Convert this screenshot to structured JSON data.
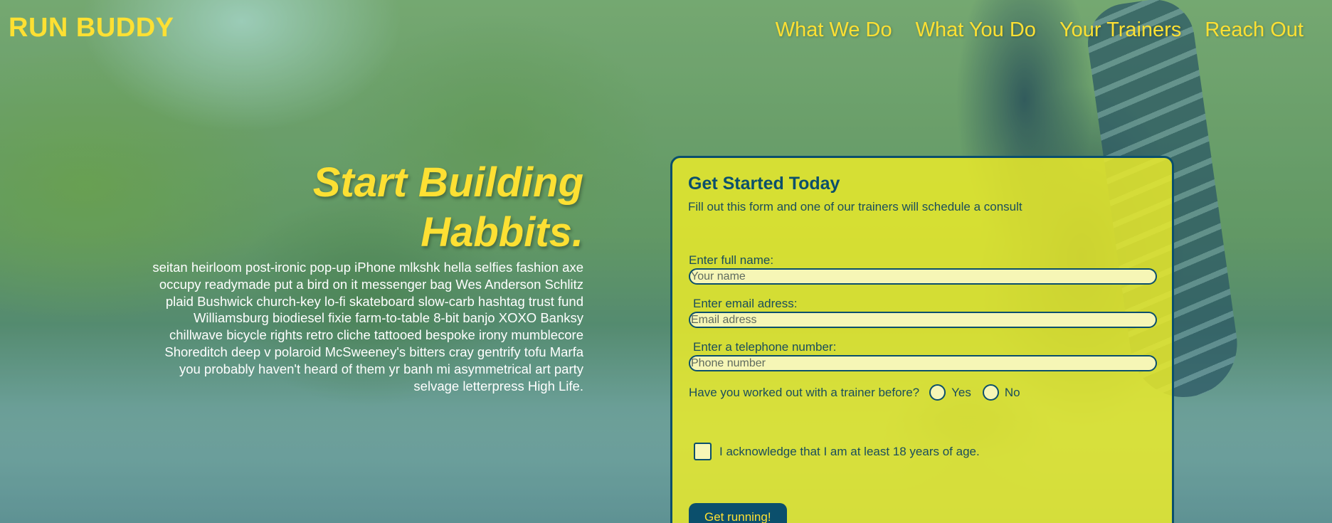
{
  "header": {
    "logo": "RUN BUDDY",
    "nav": [
      {
        "label": "What We Do"
      },
      {
        "label": "What You Do"
      },
      {
        "label": "Your Trainers"
      },
      {
        "label": "Reach Out"
      }
    ]
  },
  "hero": {
    "title_line1": "Start Building",
    "title_line2": "Habbits.",
    "body": "seitan heirloom post-ironic pop-up iPhone mlkshk hella selfies fashion axe occupy readymade put a bird on it messenger bag Wes Anderson Schlitz plaid Bushwick church-key lo-fi skateboard slow-carb hashtag trust fund Williamsburg biodiesel fixie farm-to-table 8-bit banjo XOXO Banksy chillwave bicycle rights retro cliche tattooed bespoke irony mumblecore Shoreditch deep v polaroid McSweeney's bitters cray gentrify tofu Marfa you probably haven't heard of them yr banh mi asymmetrical art party selvage letterpress High Life."
  },
  "form": {
    "title": "Get Started Today",
    "subtitle": "Fill out this form and one of our trainers will schedule a consult",
    "name": {
      "label": "Enter full name:",
      "placeholder": "Your name",
      "value": ""
    },
    "email": {
      "label": "Enter email adress:",
      "placeholder": "Email adress",
      "value": ""
    },
    "phone": {
      "label": "Enter a telephone number:",
      "placeholder": "Phone number",
      "value": ""
    },
    "trainer_question": "Have you worked out with a trainer before?",
    "options": {
      "yes": "Yes",
      "no": "No"
    },
    "acknowledge": "I acknowledge that I am at least 18 years of age.",
    "submit_label": "Get running!"
  },
  "colors": {
    "accent_yellow": "#fde033",
    "dark_blue": "#0b4f6c",
    "card_yellow": "#ecec2a"
  }
}
